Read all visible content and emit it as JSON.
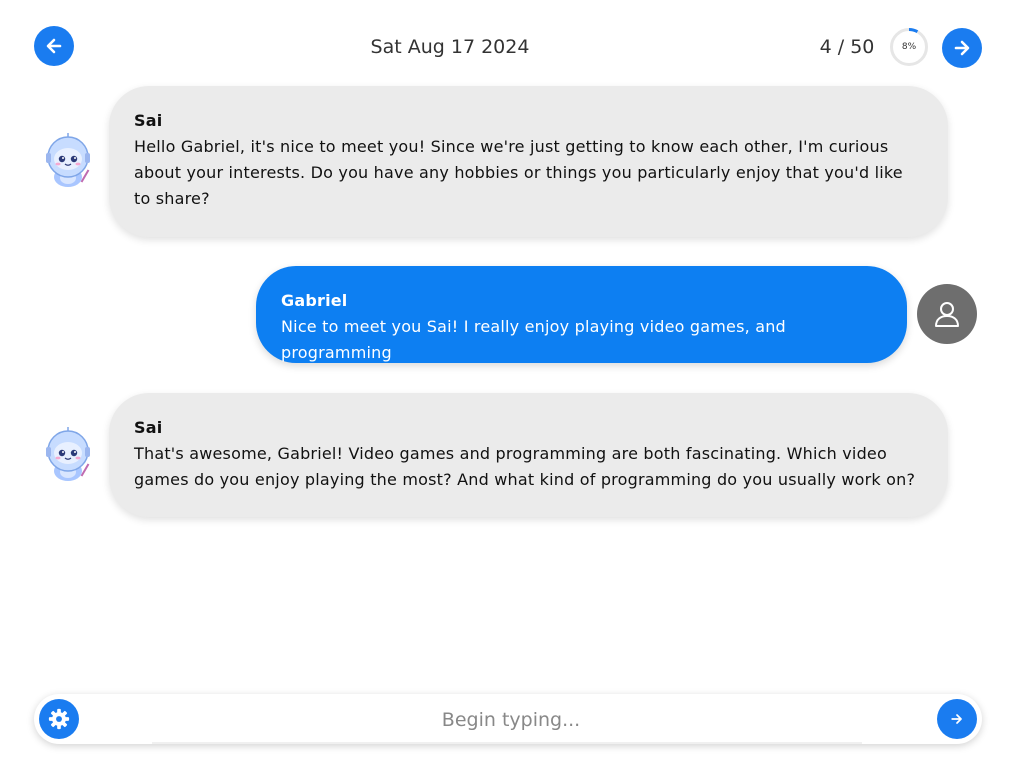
{
  "header": {
    "date": "Sat Aug 17 2024",
    "counter": "4 / 50",
    "progress_label": "8%",
    "progress_value": 0.08
  },
  "messages": [
    {
      "sender": "Sai",
      "role": "bot",
      "text": "Hello Gabriel, it's nice to meet you! Since we're just getting to know each other, I'm curious about your interests. Do you have any hobbies or things you particularly enjoy that you'd like to share?"
    },
    {
      "sender": "Gabriel",
      "role": "user",
      "text": "Nice to meet you Sai! I really enjoy playing video games, and programming"
    },
    {
      "sender": "Sai",
      "role": "bot",
      "text": "That's awesome, Gabriel! Video games and programming are both fascinating. Which video games do you enjoy playing the most? And what kind of programming do you usually work on?"
    }
  ],
  "composer": {
    "placeholder": "Begin typing..."
  },
  "icons": {
    "prev": "arrow-left-icon",
    "next": "arrow-right-icon",
    "settings": "gear-icon",
    "send": "send-arrow-icon",
    "user": "user-icon",
    "bot": "robot-avatar"
  },
  "colors": {
    "accent": "#1a7cf0",
    "user_bubble": "#0d7ff2",
    "bot_bubble": "#ebebeb",
    "user_avatar_bg": "#6e6e6e"
  }
}
